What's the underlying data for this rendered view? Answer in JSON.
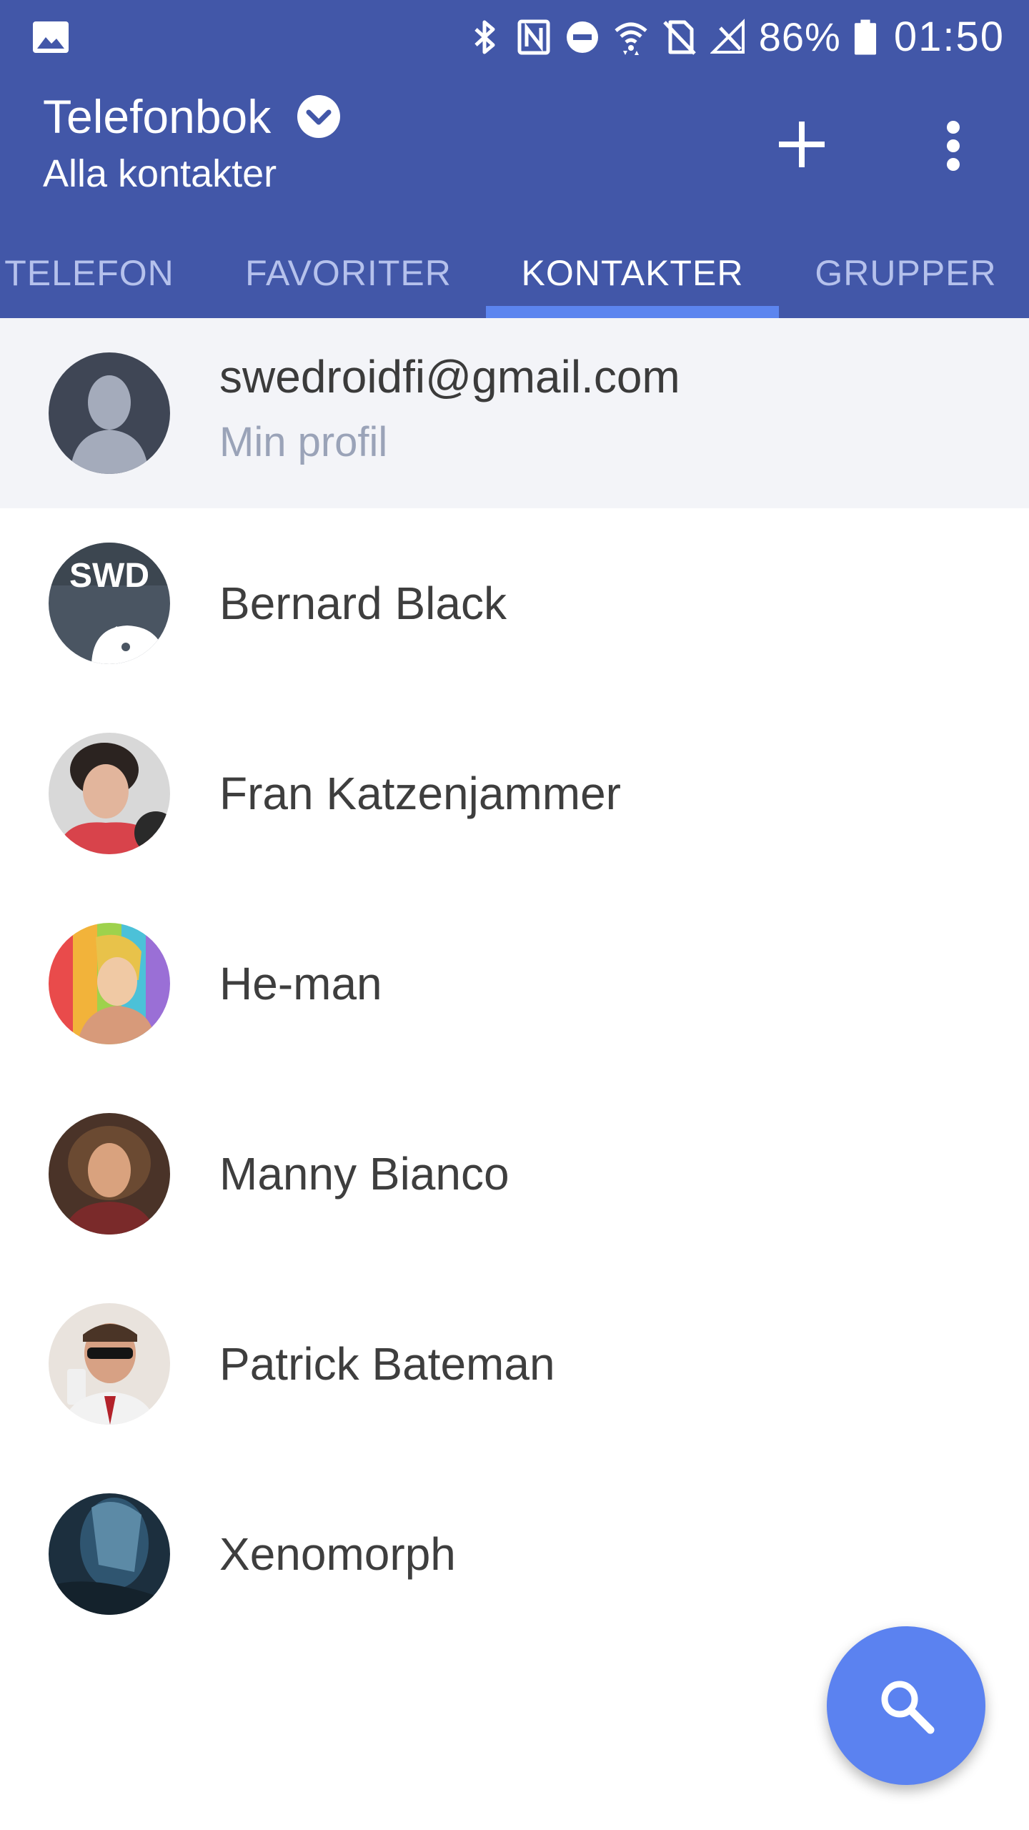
{
  "status_bar": {
    "battery_percent": "86%",
    "time": "01:50",
    "icons": [
      "gallery-icon",
      "bluetooth-icon",
      "nfc-icon",
      "do-not-disturb-icon",
      "wifi-icon",
      "no-sim-icon",
      "signal-off-icon",
      "battery-icon"
    ]
  },
  "app_bar": {
    "title": "Telefonbok",
    "subtitle": "Alla kontakter",
    "actions": [
      "add-icon",
      "more-vert-icon"
    ]
  },
  "tabs": [
    {
      "label": "TELEFON",
      "active": false
    },
    {
      "label": "FAVORITER",
      "active": false
    },
    {
      "label": "KONTAKTER",
      "active": true
    },
    {
      "label": "GRUPPER",
      "active": false
    }
  ],
  "profile": {
    "email": "swedroidfi@gmail.com",
    "subtitle": "Min profil"
  },
  "contacts": [
    {
      "name": "Bernard Black"
    },
    {
      "name": "Fran Katzenjammer"
    },
    {
      "name": "He-man"
    },
    {
      "name": "Manny Bianco"
    },
    {
      "name": "Patrick Bateman"
    },
    {
      "name": "Xenomorph"
    }
  ],
  "fab": {
    "icon": "search-icon"
  },
  "colors": {
    "app_bar": "#4257a8",
    "tab_indicator": "#5c85ef",
    "tab_inactive": "#b5c1ec",
    "fab": "#5b82f0",
    "profile_row": "#f3f4f8"
  }
}
